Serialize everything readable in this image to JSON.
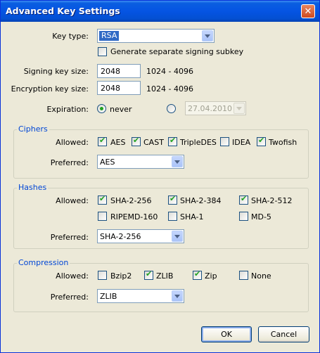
{
  "window": {
    "title": "Advanced Key Settings"
  },
  "key_type": {
    "label": "Key type:",
    "value": "RSA",
    "subkey_label": "Generate separate signing subkey",
    "subkey_checked": false
  },
  "signing": {
    "label": "Signing key size:",
    "value": "2048",
    "range": "1024 - 4096"
  },
  "encryption": {
    "label": "Encryption key size:",
    "value": "2048",
    "range": "1024 - 4096"
  },
  "expiration": {
    "label": "Expiration:",
    "never_label": "never",
    "date_value": "27.04.2010"
  },
  "ciphers": {
    "title": "Ciphers",
    "allowed_label": "Allowed:",
    "items": [
      {
        "label": "AES",
        "checked": true
      },
      {
        "label": "CAST",
        "checked": true
      },
      {
        "label": "TripleDES",
        "checked": true
      },
      {
        "label": "IDEA",
        "checked": false
      },
      {
        "label": "Twofish",
        "checked": true
      }
    ],
    "preferred_label": "Preferred:",
    "preferred_value": "AES"
  },
  "hashes": {
    "title": "Hashes",
    "allowed_label": "Allowed:",
    "items": [
      {
        "label": "SHA-2-256",
        "checked": true
      },
      {
        "label": "SHA-2-384",
        "checked": true
      },
      {
        "label": "SHA-2-512",
        "checked": true
      },
      {
        "label": "RIPEMD-160",
        "checked": false
      },
      {
        "label": "SHA-1",
        "checked": false
      },
      {
        "label": "MD-5",
        "checked": false
      }
    ],
    "preferred_label": "Preferred:",
    "preferred_value": "SHA-2-256"
  },
  "compression": {
    "title": "Compression",
    "allowed_label": "Allowed:",
    "items": [
      {
        "label": "Bzip2",
        "checked": false
      },
      {
        "label": "ZLIB",
        "checked": true
      },
      {
        "label": "Zip",
        "checked": true
      },
      {
        "label": "None",
        "checked": false
      }
    ],
    "preferred_label": "Preferred:",
    "preferred_value": "ZLIB"
  },
  "buttons": {
    "ok": "OK",
    "cancel": "Cancel"
  },
  "colors": {
    "title_bar": "#0554e3",
    "accent": "#316ac5",
    "group_title": "#0046d5",
    "check": "#21a121"
  }
}
